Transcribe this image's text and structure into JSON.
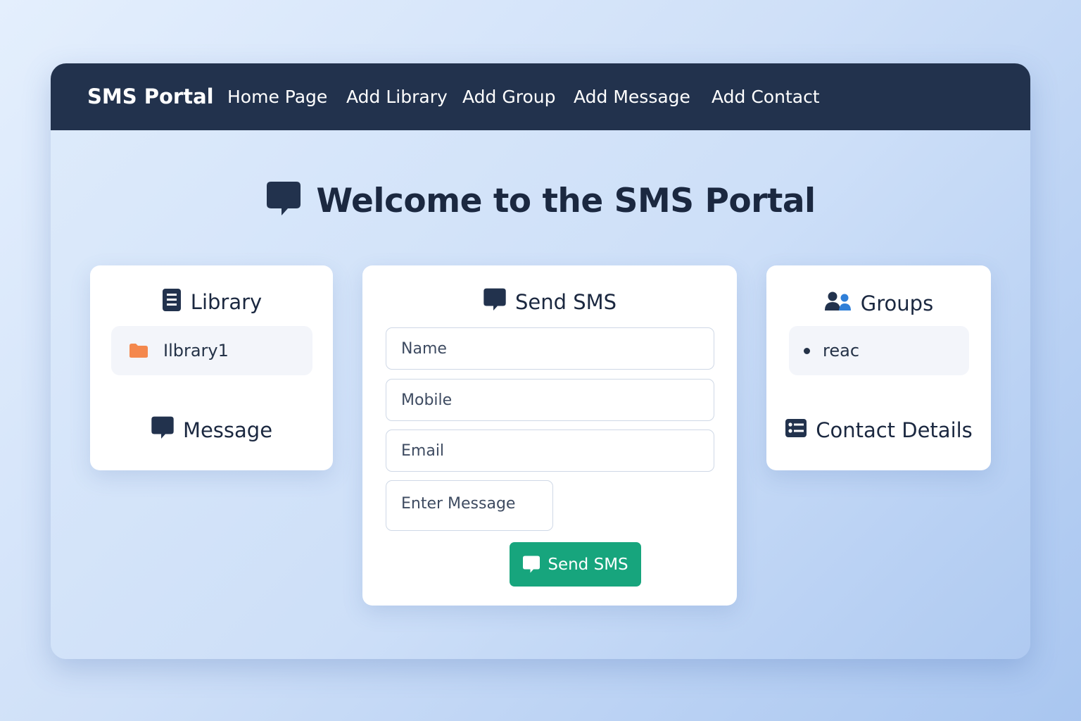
{
  "nav": {
    "brand": "SMS Portal",
    "items": [
      "Home Page",
      "Add Library",
      "Add Group",
      "Add Message",
      "Add Contact"
    ]
  },
  "hero": {
    "title": "Welcome to the SMS Portal",
    "icon": "chat-bubble-icon"
  },
  "library_card": {
    "title": "Library",
    "icon": "book-icon",
    "items": [
      {
        "label": "Ilbrary1",
        "icon": "folder-icon"
      }
    ],
    "message_title": "Message",
    "message_icon": "chat-bubble-icon"
  },
  "send_card": {
    "title": "Send SMS",
    "icon": "chat-bubble-icon",
    "name_placeholder": "Name",
    "mobile_placeholder": "Mobile",
    "email_placeholder": "Email",
    "message_placeholder": "Enter Message",
    "button_label": "Send SMS"
  },
  "groups_card": {
    "title": "Groups",
    "icon": "users-icon",
    "items": [
      "reac"
    ],
    "contact_title": "Contact Details",
    "contact_icon": "address-card-icon"
  },
  "colors": {
    "navbar": "#22324d",
    "accent_green": "#17a57d",
    "folder": "#f4884d",
    "users_blue": "#2f7fd8"
  }
}
